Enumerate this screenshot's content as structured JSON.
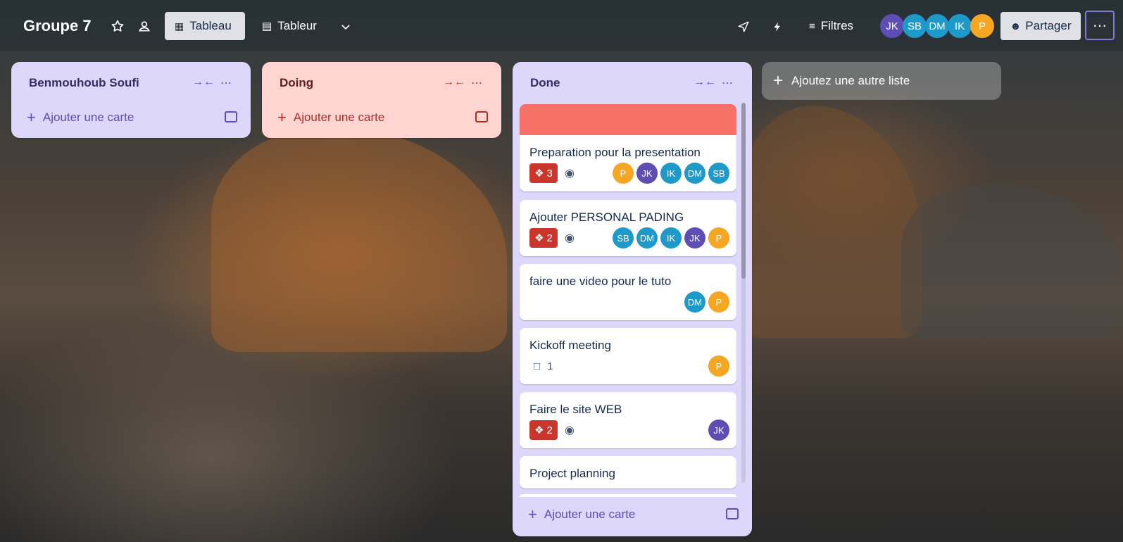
{
  "header": {
    "board_title": "Groupe 7",
    "views": [
      {
        "label": "Tableau",
        "active": true
      },
      {
        "label": "Tableur",
        "active": false
      }
    ],
    "filter_label": "Filtres",
    "share_label": "Partager",
    "members": [
      {
        "initials": "JK",
        "color": "#5e4db2"
      },
      {
        "initials": "SB",
        "color": "#1d9ac9"
      },
      {
        "initials": "DM",
        "color": "#1d9ac9"
      },
      {
        "initials": "IK",
        "color": "#1d9ac9"
      },
      {
        "initials": "P",
        "color": "#f5a623"
      }
    ]
  },
  "lists": [
    {
      "title": "Benmouhoub Soufi",
      "add_card_label": "Ajouter une carte",
      "bg": "#dcd7fb",
      "accent": "#5e4db2"
    },
    {
      "title": "Doing",
      "add_card_label": "Ajouter une carte",
      "bg": "#ffd5d2",
      "accent": "#ae2e24"
    },
    {
      "title": "Done",
      "add_card_label": "Ajouter une carte",
      "bg": "#dcd7fb",
      "accent": "#5e4db2",
      "cards": [
        {
          "title": "Preparation pour la presentation",
          "badge": "3",
          "watch": true,
          "members": [
            {
              "i": "P",
              "c": "#f5a623"
            },
            {
              "i": "JK",
              "c": "#5e4db2"
            },
            {
              "i": "IK",
              "c": "#1d9ac9"
            },
            {
              "i": "DM",
              "c": "#1d9ac9"
            },
            {
              "i": "SB",
              "c": "#1d9ac9"
            }
          ]
        },
        {
          "title": "Ajouter PERSONAL PADING",
          "badge": "2",
          "watch": true,
          "members": [
            {
              "i": "SB",
              "c": "#1d9ac9"
            },
            {
              "i": "DM",
              "c": "#1d9ac9"
            },
            {
              "i": "IK",
              "c": "#1d9ac9"
            },
            {
              "i": "JK",
              "c": "#5e4db2"
            },
            {
              "i": "P",
              "c": "#f5a623"
            }
          ]
        },
        {
          "title": "faire une video pour le tuto",
          "members": [
            {
              "i": "DM",
              "c": "#1d9ac9"
            },
            {
              "i": "P",
              "c": "#f5a623"
            }
          ]
        },
        {
          "title": "Kickoff meeting",
          "comments": "1",
          "members": [
            {
              "i": "P",
              "c": "#f5a623"
            }
          ]
        },
        {
          "title": "Faire le site WEB",
          "badge": "2",
          "watch": true,
          "members": [
            {
              "i": "JK",
              "c": "#5e4db2"
            }
          ]
        },
        {
          "title": "Project planning"
        }
      ]
    }
  ],
  "add_list_label": "Ajoutez une autre liste",
  "colors": {
    "cover": "#f87168",
    "badge_red": "#c9372c",
    "header_overlay": "rgba(30,40,45,0.45)"
  }
}
